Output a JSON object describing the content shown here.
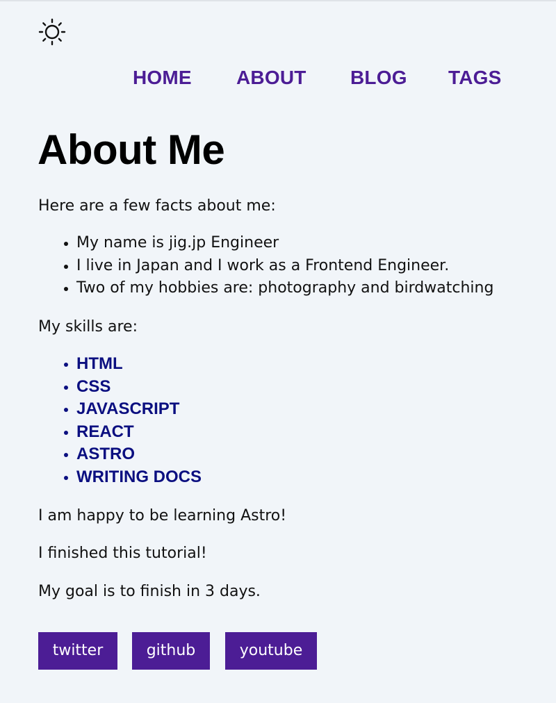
{
  "header": {
    "theme_toggle_icon": "sun-icon"
  },
  "nav": {
    "items": [
      {
        "label": "HOME"
      },
      {
        "label": "ABOUT"
      },
      {
        "label": "BLOG"
      },
      {
        "label": "TAGS"
      }
    ]
  },
  "main": {
    "title": "About Me",
    "intro": "Here are a few facts about me:",
    "facts": [
      "My name is jig.jp Engineer",
      "I live in Japan and I work as a Frontend Engineer.",
      "Two of my hobbies are: photography and birdwatching"
    ],
    "skills_label": "My skills are:",
    "skills": [
      "HTML",
      "CSS",
      "JAVASCRIPT",
      "REACT",
      "ASTRO",
      "WRITING DOCS"
    ],
    "happy": "I am happy to be learning Astro!",
    "finished": "I finished this tutorial!",
    "goal": "My goal is to finish in 3 days."
  },
  "social": {
    "links": [
      {
        "label": "twitter"
      },
      {
        "label": "github"
      },
      {
        "label": "youtube"
      }
    ]
  },
  "colors": {
    "background": "#f1f5f9",
    "accent": "#4c1d95",
    "skill": "#0b0f80"
  }
}
